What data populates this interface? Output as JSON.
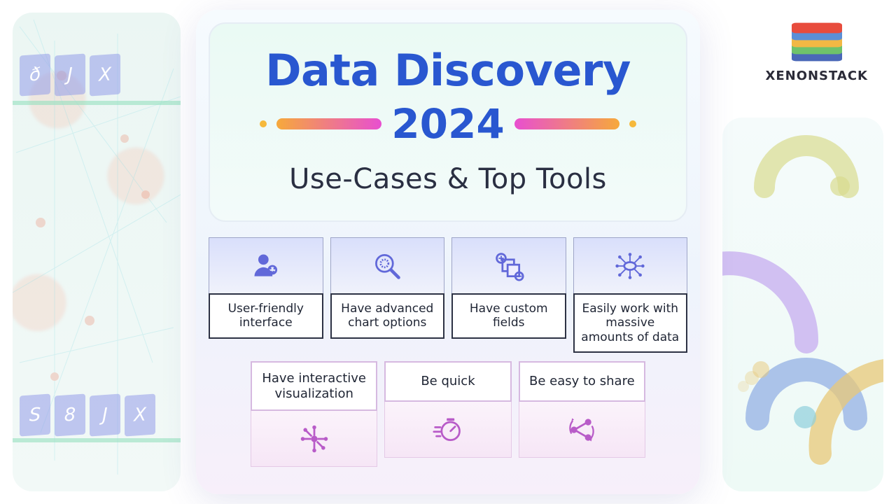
{
  "brand": {
    "name": "XENONSTACK"
  },
  "title": {
    "main": "Data Discovery",
    "year": "2024",
    "subtitle": "Use-Cases & Top Tools"
  },
  "features_top": [
    {
      "icon": "user-friendly-icon",
      "label": "User-friendly interface"
    },
    {
      "icon": "chart-options-icon",
      "label": "Have advanced chart options"
    },
    {
      "icon": "custom-fields-icon",
      "label": "Have custom fields"
    },
    {
      "icon": "massive-data-icon",
      "label": "Easily work with massive amounts of data"
    }
  ],
  "features_bottom": [
    {
      "icon": "interactive-viz-icon",
      "label": "Have interactive visualization"
    },
    {
      "icon": "quick-icon",
      "label": "Be quick"
    },
    {
      "icon": "share-icon",
      "label": "Be easy to share"
    }
  ],
  "colors": {
    "title_blue": "#2957d0",
    "accent_purple": "#b85bc8",
    "accent_indigo": "#6168d9",
    "dot_orange": "#f6b93b"
  }
}
